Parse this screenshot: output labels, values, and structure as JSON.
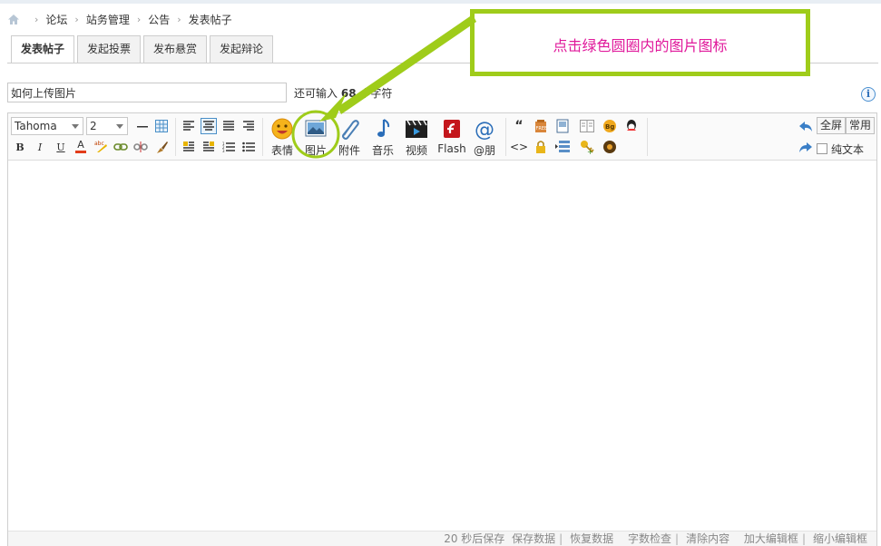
{
  "breadcrumb": {
    "items": [
      "论坛",
      "站务管理",
      "公告",
      "发表帖子"
    ],
    "sep": "›"
  },
  "tabs": [
    {
      "label": "发表帖子",
      "active": true
    },
    {
      "label": "发起投票",
      "active": false
    },
    {
      "label": "发布悬赏",
      "active": false
    },
    {
      "label": "发起辩论",
      "active": false
    }
  ],
  "subject": {
    "value": "如何上传图片",
    "hint_before": "还可输入",
    "hint_count": "68",
    "hint_after": "个字符"
  },
  "info_icon_text": "i",
  "toolbar": {
    "font_family": "Tahoma",
    "font_size": "2",
    "bold": "B",
    "italic": "I",
    "underline": "U",
    "color": "A",
    "big_buttons": {
      "smiley": "表情",
      "image": "图片",
      "attach": "附件",
      "music": "音乐",
      "video": "视频",
      "flash": "Flash",
      "at": "@朋"
    },
    "fullscreen": "全屏",
    "common": "常用",
    "plain_text": "纯文本",
    "quote": "“",
    "code": "<>"
  },
  "status": {
    "autosave": "20 秒后保存",
    "save": "保存数据",
    "restore": "恢复数据",
    "check": "字数检查",
    "clear": "清除内容",
    "enlarge": "加大编辑框",
    "shrink": "缩小编辑框"
  },
  "annotation": {
    "text": "点击绿色圆圈内的图片图标"
  },
  "colors": {
    "accent_green": "#9fcc1a",
    "annotation_text": "#e0199b"
  }
}
